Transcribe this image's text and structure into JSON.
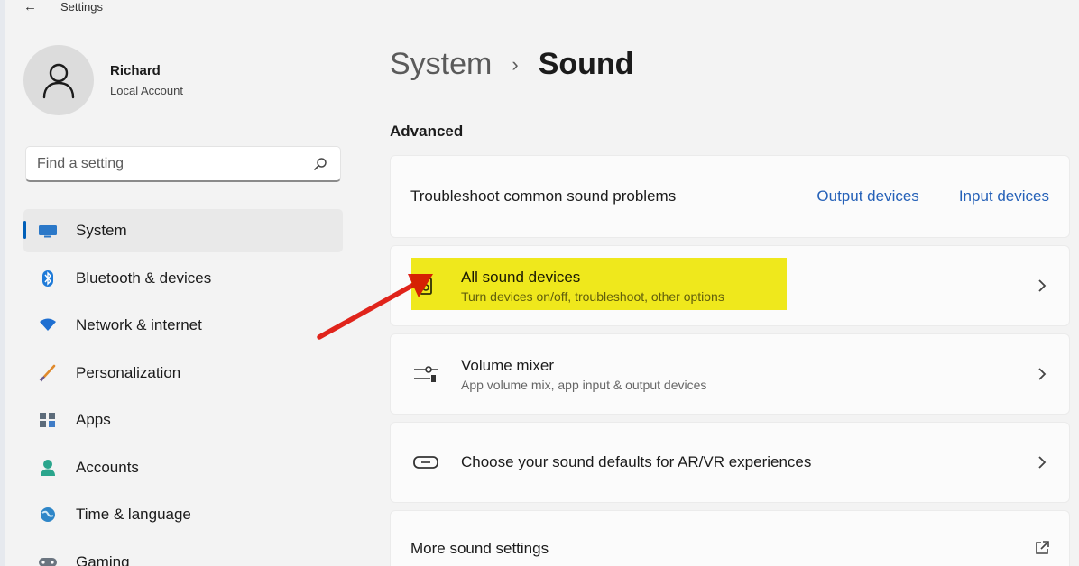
{
  "window": {
    "title": "Settings",
    "back_icon": "back-arrow-icon"
  },
  "profile": {
    "name": "Richard",
    "account_type": "Local Account",
    "avatar_icon": "person-icon"
  },
  "search": {
    "placeholder": "Find a setting",
    "icon": "search-icon"
  },
  "sidebar": {
    "items": [
      {
        "label": "System",
        "icon": "system-monitor-icon",
        "active": true
      },
      {
        "label": "Bluetooth & devices",
        "icon": "bluetooth-icon",
        "active": false
      },
      {
        "label": "Network & internet",
        "icon": "wifi-icon",
        "active": false
      },
      {
        "label": "Personalization",
        "icon": "brush-icon",
        "active": false
      },
      {
        "label": "Apps",
        "icon": "apps-icon",
        "active": false
      },
      {
        "label": "Accounts",
        "icon": "accounts-icon",
        "active": false
      },
      {
        "label": "Time & language",
        "icon": "globe-clock-icon",
        "active": false
      },
      {
        "label": "Gaming",
        "icon": "gaming-icon",
        "active": false
      }
    ]
  },
  "breadcrumb": {
    "parent": "System",
    "separator": "›",
    "current": "Sound"
  },
  "main": {
    "section_heading": "Advanced",
    "troubleshoot": {
      "label": "Troubleshoot common sound problems",
      "output_link": "Output devices",
      "input_link": "Input devices"
    },
    "rows": [
      {
        "title": "All sound devices",
        "subtitle": "Turn devices on/off, troubleshoot, other options",
        "icon": "speaker-devices-icon",
        "action": "chevron-right-icon",
        "highlighted": true
      },
      {
        "title": "Volume mixer",
        "subtitle": "App volume mix, app input & output devices",
        "icon": "volume-mixer-icon",
        "action": "chevron-right-icon"
      },
      {
        "title": "Choose your sound defaults for AR/VR experiences",
        "subtitle": "",
        "icon": "vr-headset-icon",
        "action": "chevron-right-icon"
      },
      {
        "title": "More sound settings",
        "subtitle": "",
        "icon": "",
        "action": "external-link-icon"
      }
    ]
  },
  "colors": {
    "accent": "#005fb8",
    "link": "#2561b8",
    "highlight": "#f3ec1c",
    "annotation_arrow": "#e0241b"
  }
}
